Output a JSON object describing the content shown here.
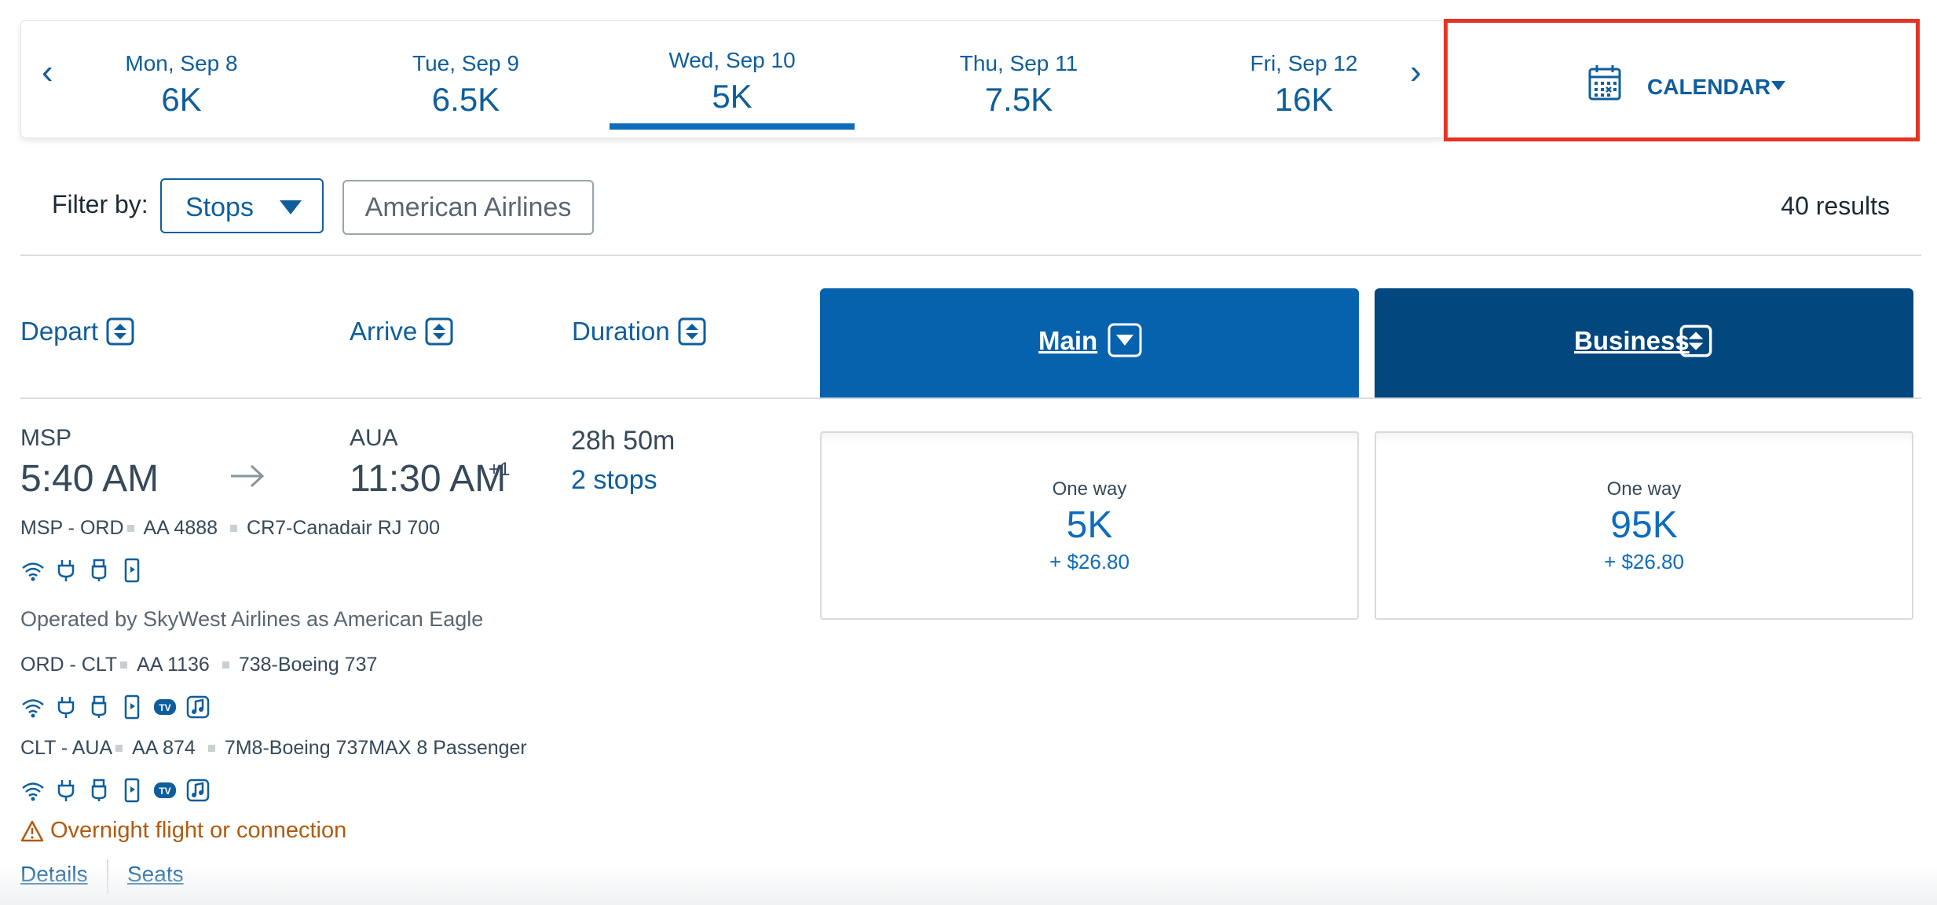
{
  "date_strip": {
    "prev_arrow": "‹",
    "next_arrow": "›",
    "dates": [
      {
        "label": "Mon, Sep 8",
        "price": "6K"
      },
      {
        "label": "Tue, Sep 9",
        "price": "6.5K"
      },
      {
        "label": "Wed, Sep 10",
        "price": "5K",
        "selected": true
      },
      {
        "label": "Thu, Sep 11",
        "price": "7.5K"
      },
      {
        "label": "Fri, Sep 12",
        "price": "16K"
      }
    ],
    "calendar_label": "CALENDAR"
  },
  "filters": {
    "label": "Filter by:",
    "stops_label": "Stops",
    "airline_chip": "American Airlines",
    "results": "40 results"
  },
  "columns": {
    "depart": "Depart",
    "arrive": "Arrive",
    "duration": "Duration",
    "main": "Main",
    "business": "Business"
  },
  "flight": {
    "origin": "MSP",
    "destination": "AUA",
    "depart_time": "5:40 AM",
    "arrive_time": "11:30 AM",
    "plus_day": "+1",
    "duration": "28h 50m",
    "stops": "2 stops",
    "segments": [
      {
        "route": "MSP - ORD",
        "flight": "AA 4888",
        "aircraft": "CR7-Canadair RJ 700",
        "amenities": [
          "wifi-icon",
          "power-icon",
          "usb-icon",
          "mobile-entertainment-icon"
        ]
      },
      {
        "route": "ORD - CLT",
        "flight": "AA 1136",
        "aircraft": "738-Boeing 737",
        "amenities": [
          "wifi-icon",
          "power-icon",
          "usb-icon",
          "mobile-entertainment-icon",
          "tv-icon",
          "audio-icon"
        ]
      },
      {
        "route": "CLT - AUA",
        "flight": "AA 874",
        "aircraft": "7M8-Boeing 737MAX 8 Passenger",
        "amenities": [
          "wifi-icon",
          "power-icon",
          "usb-icon",
          "mobile-entertainment-icon",
          "tv-icon",
          "audio-icon"
        ]
      }
    ],
    "operated_by": "Operated by SkyWest Airlines as American Eagle",
    "overnight_warning": "Overnight flight or connection",
    "details_link": "Details",
    "seats_link": "Seats",
    "main_fare": {
      "type": "One way",
      "points": "5K",
      "tax": "+ $26.80"
    },
    "business_fare": {
      "type": "One way",
      "points": "95K",
      "tax": "+ $26.80"
    }
  },
  "tv_badge": "TV",
  "colors": {
    "brand_blue": "#0f5e9c",
    "main_header": "#0662ad",
    "business_header": "#03477f",
    "highlight_border": "#e63323",
    "warning": "#b15a10"
  }
}
